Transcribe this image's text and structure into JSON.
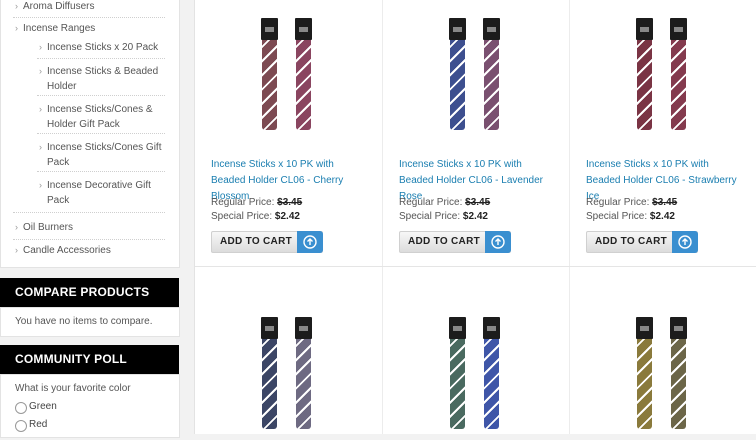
{
  "categories": {
    "aroma": "Aroma Diffusers",
    "incense_ranges": "Incense Ranges",
    "sub": [
      "Incense Sticks x 20 Pack",
      "Incense Sticks & Beaded Holder",
      "Incense Sticks/Cones & Holder Gift Pack",
      "Incense Sticks/Cones Gift Pack",
      "Incense Decorative Gift Pack"
    ],
    "oil": "Oil Burners",
    "candle": "Candle Accessories"
  },
  "compare": {
    "title": "COMPARE PRODUCTS",
    "empty_text": "You have no items to compare."
  },
  "poll": {
    "title": "COMMUNITY POLL",
    "question": "What is your favorite color",
    "options": [
      "Green",
      "Red"
    ]
  },
  "products": [
    {
      "title": "Incense Sticks x 10 PK with Beaded Holder CL06 - Cherry Blossom",
      "regular_label": "Regular Price:",
      "regular_price": "$3.45",
      "special_label": "Special Price:",
      "special_price": "$2.42",
      "cart_label": "ADD TO CART",
      "colors": [
        "#7d4a52",
        "#8a4560"
      ]
    },
    {
      "title": "Incense Sticks x 10 PK with Beaded Holder CL06 - Lavender Rose",
      "regular_label": "Regular Price:",
      "regular_price": "$3.45",
      "special_label": "Special Price:",
      "special_price": "$2.42",
      "cart_label": "ADD TO CART",
      "colors": [
        "#3d4f8f",
        "#7a5070"
      ]
    },
    {
      "title": "Incense Sticks x 10 PK with Beaded Holder CL06 - Strawberry Ice",
      "regular_label": "Regular Price:",
      "regular_price": "$3.45",
      "special_label": "Special Price:",
      "special_price": "$2.42",
      "cart_label": "ADD TO CART",
      "colors": [
        "#7a3444",
        "#843a4e"
      ]
    },
    {
      "colors": [
        "#3c4666",
        "#6e6a82"
      ]
    },
    {
      "colors": [
        "#4a6a60",
        "#3f56a8"
      ]
    },
    {
      "colors": [
        "#8a7a3c",
        "#6c6648"
      ]
    }
  ],
  "accent_colors": {
    "link": "#1a7eb0",
    "cart_icon": "#3a8fd0",
    "block_title_bg": "#000000"
  }
}
